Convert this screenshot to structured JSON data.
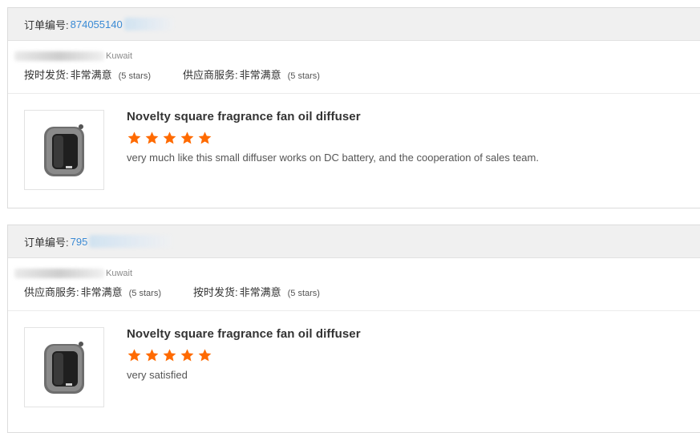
{
  "reviews": [
    {
      "order_label": "订单编号:",
      "order_number": "874055140",
      "country": "Kuwait",
      "ratings": [
        {
          "label": "按时发货:",
          "value": "非常满意",
          "stars": "(5 stars)"
        },
        {
          "label": "供应商服务:",
          "value": "非常满意",
          "stars": "(5 stars)"
        }
      ],
      "product_title": "Novelty square fragrance fan oil diffuser",
      "star_rating": 5,
      "review_text": "very much like this small diffuser works on DC battery, and the cooperation of sales team."
    },
    {
      "order_label": "订单编号:",
      "order_number": "795",
      "country": "Kuwait",
      "ratings": [
        {
          "label": "供应商服务:",
          "value": "非常满意",
          "stars": "(5 stars)"
        },
        {
          "label": "按时发货:",
          "value": "非常满意",
          "stars": "(5 stars)"
        }
      ],
      "product_title": "Novelty square fragrance fan oil diffuser",
      "star_rating": 5,
      "review_text": "very satisfied"
    }
  ],
  "colors": {
    "star": "#ff6a00",
    "order_link": "#3a8ad4",
    "header_bg": "#f0f0f0"
  },
  "icons": {
    "star": "star-icon",
    "product": "diffuser-product-image"
  }
}
